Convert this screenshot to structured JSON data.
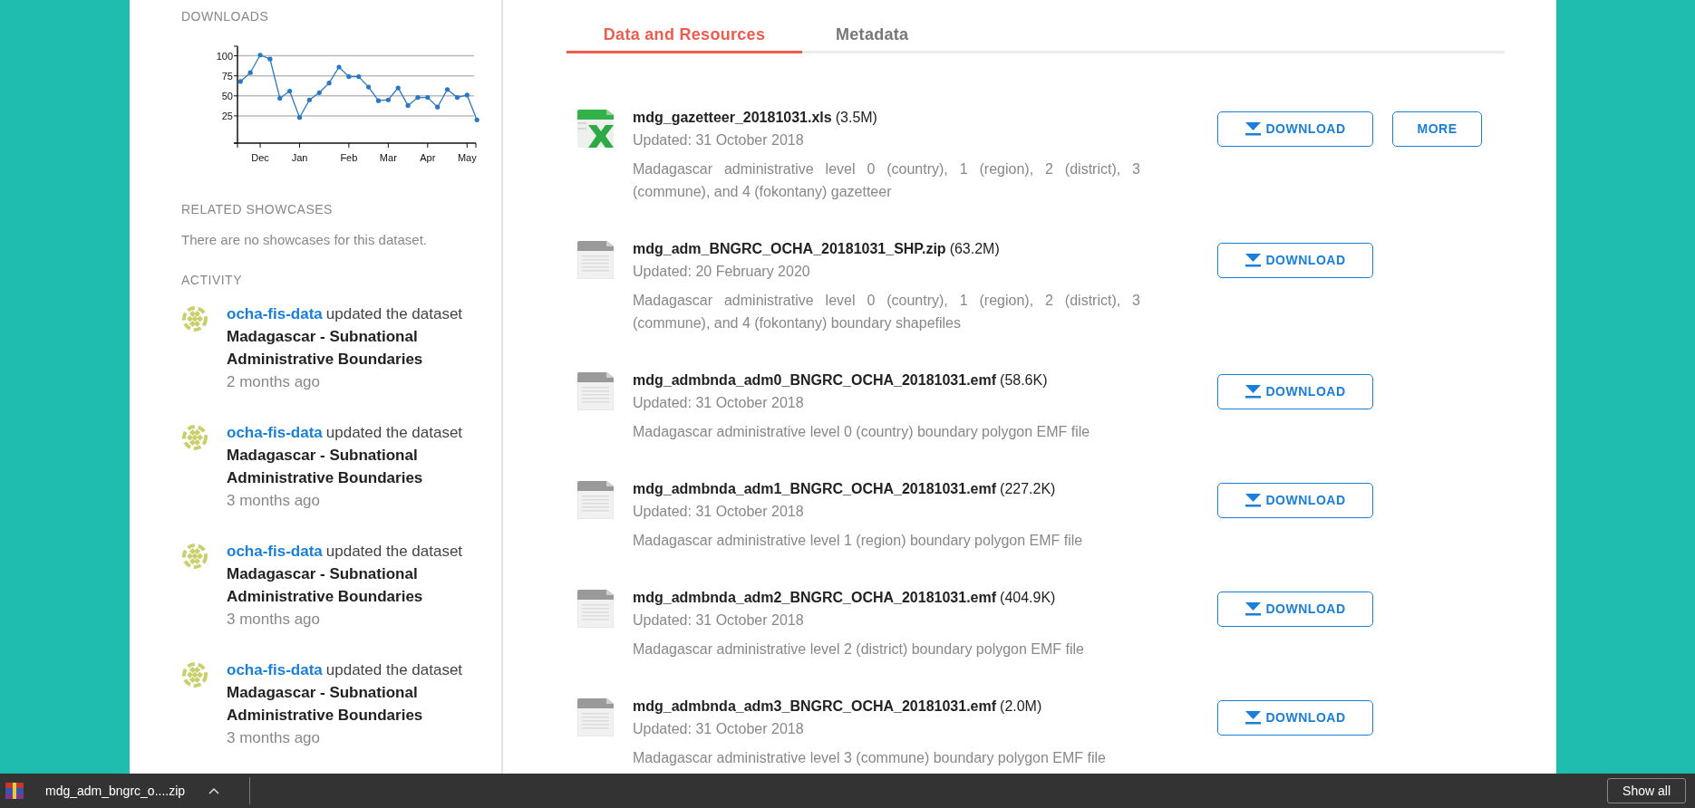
{
  "sidebar": {
    "downloads": {
      "title": "DOWNLOADS",
      "chart_data": {
        "type": "line",
        "categories": [
          null,
          null,
          "Dec",
          null,
          null,
          null,
          "Jan",
          null,
          null,
          null,
          null,
          "Feb",
          null,
          null,
          null,
          "Mar",
          null,
          null,
          null,
          "Apr",
          null,
          null,
          null,
          "May",
          null
        ],
        "ylim": [
          -9,
          112
        ],
        "grid": true,
        "series": [
          {
            "color": "#2a78c2",
            "values": [
              68,
              79,
              101,
              96,
              47,
              56,
              23,
              45,
              54,
              66,
              86,
              74,
              74,
              61,
              44,
              45,
              60,
              38,
              48,
              48,
              36,
              58,
              48,
              51,
              20
            ]
          }
        ],
        "yticks": [
          25,
          50,
          75,
          100
        ]
      }
    },
    "showcases": {
      "title": "RELATED SHOWCASES",
      "text": "There are no showcases for this dataset."
    },
    "activity": {
      "title": "ACTIVITY",
      "items": [
        {
          "user": "ocha-fis-data",
          "action": "updated the dataset",
          "dataset": "Madagascar - Subnational Administrative Boundaries",
          "time": "2 months ago"
        },
        {
          "user": "ocha-fis-data",
          "action": "updated the dataset",
          "dataset": "Madagascar - Subnational Administrative Boundaries",
          "time": "3 months ago"
        },
        {
          "user": "ocha-fis-data",
          "action": "updated the dataset",
          "dataset": "Madagascar - Subnational Administrative Boundaries",
          "time": "3 months ago"
        },
        {
          "user": "ocha-fis-data",
          "action": "updated the dataset",
          "dataset": "Madagascar - Subnational Administrative Boundaries",
          "time": "3 months ago"
        }
      ]
    }
  },
  "tabs": [
    {
      "label": "Data and Resources",
      "selected": true
    },
    {
      "label": "Metadata",
      "selected": false
    }
  ],
  "resources": [
    {
      "kind": "xls",
      "name": "mdg_gazetteer_20181031.xls",
      "size": "(3.5M)",
      "updated": "Updated: 31 October 2018",
      "description": "Madagascar administrative level 0 (country), 1 (region), 2 (district), 3 (commune), and 4 (fokontany) gazetteer",
      "buttons": [
        {
          "kind": "download",
          "label": "DOWNLOAD"
        },
        {
          "kind": "more",
          "label": "MORE"
        }
      ]
    },
    {
      "kind": "data",
      "name": "mdg_adm_BNGRC_OCHA_20181031_SHP.zip",
      "size": "(63.2M)",
      "updated": "Updated: 20 February 2020",
      "description": "Madagascar administrative level 0 (country), 1 (region), 2 (district), 3 (commune), and 4 (fokontany) boundary shapefiles",
      "buttons": [
        {
          "kind": "download",
          "label": "DOWNLOAD"
        }
      ]
    },
    {
      "kind": "data",
      "name": "mdg_admbnda_adm0_BNGRC_OCHA_20181031.emf",
      "size": "(58.6K)",
      "updated": "Updated: 31 October 2018",
      "description": "Madagascar administrative level 0 (country) boundary polygon EMF file",
      "buttons": [
        {
          "kind": "download",
          "label": "DOWNLOAD"
        }
      ]
    },
    {
      "kind": "data",
      "name": "mdg_admbnda_adm1_BNGRC_OCHA_20181031.emf",
      "size": "(227.2K)",
      "updated": "Updated: 31 October 2018",
      "description": "Madagascar administrative level 1 (region) boundary polygon EMF file",
      "buttons": [
        {
          "kind": "download",
          "label": "DOWNLOAD"
        }
      ]
    },
    {
      "kind": "data",
      "name": "mdg_admbnda_adm2_BNGRC_OCHA_20181031.emf",
      "size": "(404.9K)",
      "updated": "Updated: 31 October 2018",
      "description": "Madagascar administrative level 2 (district) boundary polygon EMF file",
      "buttons": [
        {
          "kind": "download",
          "label": "DOWNLOAD"
        }
      ]
    },
    {
      "kind": "data",
      "name": "mdg_admbnda_adm3_BNGRC_OCHA_20181031.emf",
      "size": "(2.0M)",
      "updated": "Updated: 31 October 2018",
      "description": "Madagascar administrative level 3 (commune) boundary polygon EMF file",
      "buttons": [
        {
          "kind": "download",
          "label": "DOWNLOAD"
        }
      ]
    }
  ],
  "download_bar": {
    "file": "mdg_adm_bngrc_o....zip",
    "button": "Show all"
  }
}
